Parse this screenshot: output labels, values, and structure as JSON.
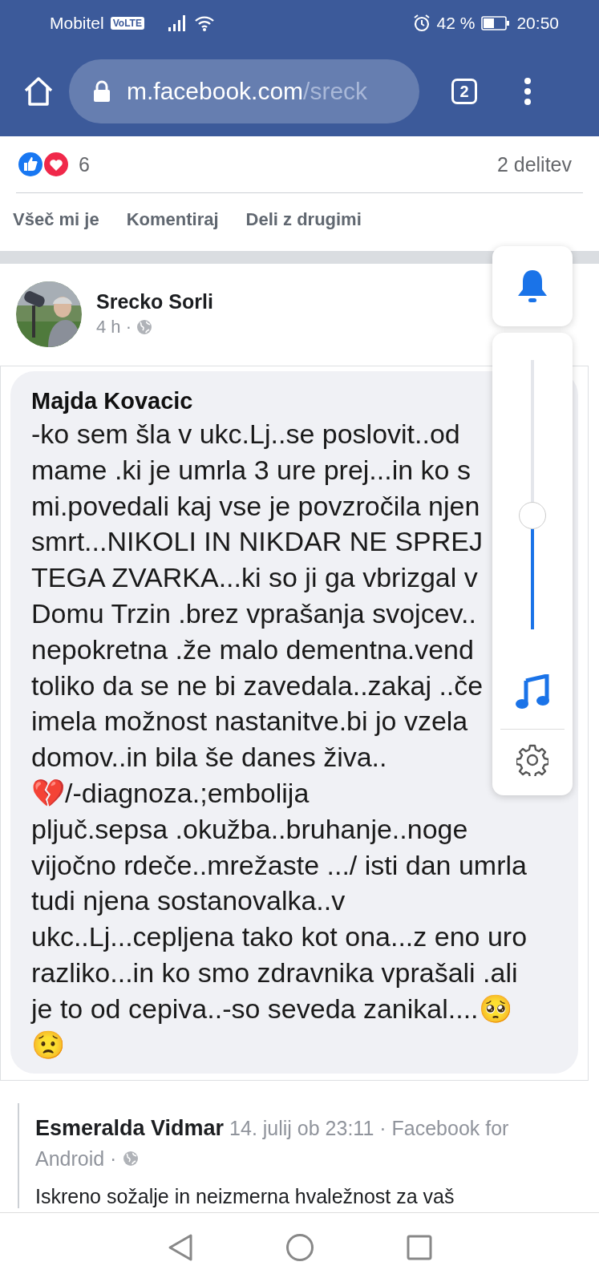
{
  "status_bar": {
    "carrier": "Mobitel",
    "volte": "VoLTE",
    "battery": "42 %",
    "time": "20:50"
  },
  "browser": {
    "url_host": "m.facebook.com",
    "url_path": "/sreck",
    "tab_count": "2"
  },
  "reactions": {
    "count": "6",
    "shares": "2 delitev"
  },
  "actions": [
    "Všeč mi je",
    "Komentiraj",
    "Deli z drugimi"
  ],
  "post": {
    "author": "Srecko Sorli",
    "time": "4 h ·",
    "shared_image": {
      "author": "Majda Kovacic",
      "lines": [
        "-ko sem šla v ukc.Lj..se poslovit..od",
        "mame .ki je umrla 3 ure prej...in ko s",
        "mi.povedali kaj vse je povzročila njen",
        "smrt...NIKOLI IN NIKDAR NE SPREJ",
        "TEGA ZVARKA...ki so ji ga vbrizgal v",
        "Domu Trzin .brez vprašanja svojcev..",
        "nepokretna .že malo dementna.vend",
        "toliko da se ne bi zavedala..zakaj ..če",
        "imela možnost nastanitve.bi jo vzela",
        "domov..in bila še danes živa..",
        "💔/-diagnoza.;embolija",
        "pljuč.sepsa .okužba..bruhanje..noge",
        "vijočno rdeče..mrežaste .../ isti dan umrla",
        "tudi njena sostanovalka..v",
        "ukc..Lj...cepljena tako kot ona...z eno uro",
        "razliko...in ko smo zdravnika  vprašali .ali",
        "je to od cepiva..-so seveda zanikal....🥺",
        "😟"
      ]
    }
  },
  "comment": {
    "author": "Esmeralda Vidmar",
    "meta": "14. julij ob 23:11 · Facebook for",
    "meta_2": "Android ·",
    "text": "Iskreno sožalje in neizmerna hvaležnost za vaš"
  },
  "volume_panel": {
    "level": 0.47
  }
}
